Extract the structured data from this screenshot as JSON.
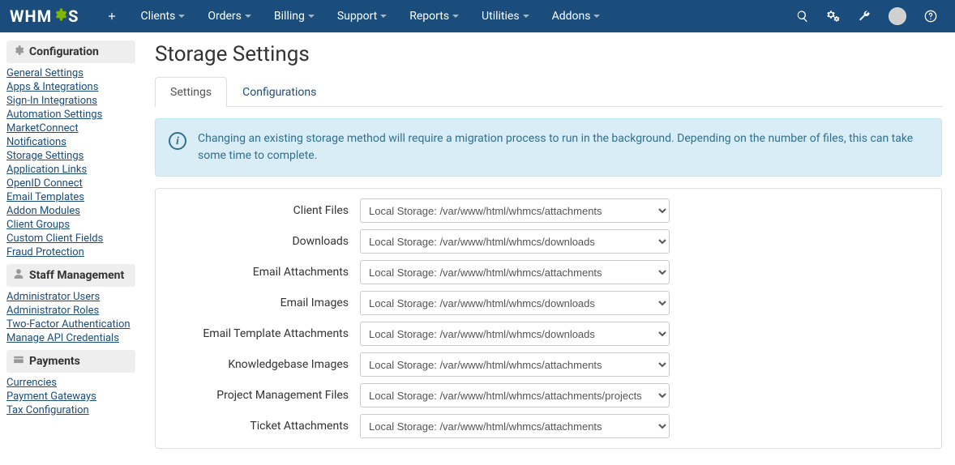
{
  "brand": {
    "pre": "WHM",
    "post": "S"
  },
  "nav": [
    {
      "label": "Clients",
      "dd": true
    },
    {
      "label": "Orders",
      "dd": true
    },
    {
      "label": "Billing",
      "dd": true
    },
    {
      "label": "Support",
      "dd": true
    },
    {
      "label": "Reports",
      "dd": true
    },
    {
      "label": "Utilities",
      "dd": true
    },
    {
      "label": "Addons",
      "dd": true
    }
  ],
  "sidebar": {
    "sections": [
      {
        "title": "Configuration",
        "icon": "gear",
        "links": [
          "General Settings",
          "Apps & Integrations",
          "Sign-In Integrations",
          "Automation Settings",
          "MarketConnect",
          "Notifications",
          "Storage Settings",
          "Application Links",
          "OpenID Connect",
          "Email Templates",
          "Addon Modules",
          "Client Groups",
          "Custom Client Fields",
          "Fraud Protection"
        ]
      },
      {
        "title": "Staff Management",
        "icon": "user",
        "links": [
          "Administrator Users",
          "Administrator Roles",
          "Two-Factor Authentication",
          "Manage API Credentials"
        ]
      },
      {
        "title": "Payments",
        "icon": "card",
        "links": [
          "Currencies",
          "Payment Gateways",
          "Tax Configuration"
        ]
      }
    ]
  },
  "page": {
    "title": "Storage Settings"
  },
  "tabs": [
    {
      "label": "Settings",
      "active": true
    },
    {
      "label": "Configurations",
      "active": false
    }
  ],
  "alert": "Changing an existing storage method will require a migration process to run in the background. Depending on the number of files, this can take some time to complete.",
  "rows": [
    {
      "label": "Client Files",
      "value": "Local Storage: /var/www/html/whmcs/attachments"
    },
    {
      "label": "Downloads",
      "value": "Local Storage: /var/www/html/whmcs/downloads"
    },
    {
      "label": "Email Attachments",
      "value": "Local Storage: /var/www/html/whmcs/attachments"
    },
    {
      "label": "Email Images",
      "value": "Local Storage: /var/www/html/whmcs/downloads"
    },
    {
      "label": "Email Template Attachments",
      "value": "Local Storage: /var/www/html/whmcs/downloads"
    },
    {
      "label": "Knowledgebase Images",
      "value": "Local Storage: /var/www/html/whmcs/attachments"
    },
    {
      "label": "Project Management Files",
      "value": "Local Storage: /var/www/html/whmcs/attachments/projects"
    },
    {
      "label": "Ticket Attachments",
      "value": "Local Storage: /var/www/html/whmcs/attachments"
    }
  ]
}
